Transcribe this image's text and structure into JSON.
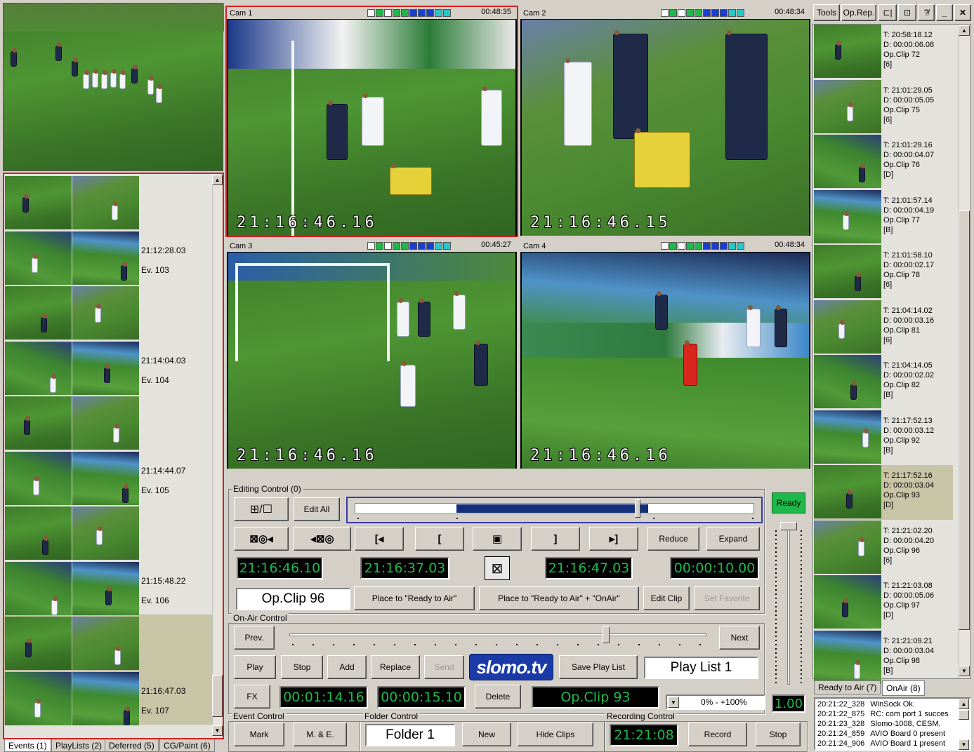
{
  "colors": {
    "meter_green": "#1fb84a",
    "meter_blue": "#1a3fd0",
    "meter_cyan": "#27c7c7",
    "lcd_text": "#1fb84a",
    "ready": "#1fb84a",
    "selected_border": "#d42020"
  },
  "cams": [
    {
      "label": "Cam 1",
      "time": "00:48:35",
      "timecode": "21:16:46.16"
    },
    {
      "label": "Cam 2",
      "time": "00:48:34",
      "timecode": "21:16:46.15"
    },
    {
      "label": "Cam 3",
      "time": "00:45:27",
      "timecode": "21:16:46.16"
    },
    {
      "label": "Cam 4",
      "time": "00:48:34",
      "timecode": "21:16:46.16"
    }
  ],
  "events": [
    {
      "time": "21:12:28.03",
      "name": "Ev. 103"
    },
    {
      "time": "21:14:04.03",
      "name": "Ev. 104"
    },
    {
      "time": "21:14:44.07",
      "name": "Ev. 105"
    },
    {
      "time": "21:15:48.22",
      "name": "Ev. 106"
    },
    {
      "time": "21:16:47.03",
      "name": "Ev. 107"
    }
  ],
  "left_tabs": [
    "Events (1)",
    "PlayLists (2)",
    "Deferred (5)",
    "CG/Paint (6)"
  ],
  "editing": {
    "group_label": "Editing Control (0)",
    "split_btn": "⊞/☐",
    "edit_all": "Edit All",
    "ready": "Ready",
    "trans_btns": [
      "▯◎◂",
      "◂▯◎",
      "[◂",
      "[",
      "▣",
      "]",
      "▸]"
    ],
    "reduce": "Reduce",
    "expand": "Expand",
    "tc_current": "21:16:46.10",
    "tc_in": "21:16:37.03",
    "tc_out": "21:16:47.03",
    "tc_dur": "00:00:10.00",
    "clip_name": "Op.Clip 96",
    "place_ready": "Place to \"Ready to Air\"",
    "place_ready_onair": "Place to \"Ready to Air\" + \"OnAir\"",
    "edit_clip": "Edit Clip",
    "set_favorite": "Set Favorite",
    "timeline_fill": 0.48
  },
  "onair": {
    "group_label": "On-Air Control",
    "prev": "Prev.",
    "next": "Next",
    "play": "Play",
    "stop": "Stop",
    "add": "Add",
    "replace": "Replace",
    "send": "Send",
    "logo": "slomo.tv",
    "save_playlist": "Save Play List",
    "playlist_name": "Play List 1",
    "fx": "FX",
    "tc_pos": "00:01:14.16",
    "tc_len": "00:00:15.10",
    "delete": "Delete",
    "onair_clip": "Op.Clip 93",
    "speed_range": "0%  -  +100%",
    "speed": "1.00",
    "slider_pos": 0.76
  },
  "event_control": {
    "group_label": "Event Control",
    "mark": "Mark",
    "me": "M. & E."
  },
  "folder_control": {
    "group_label": "Folder Control",
    "folder": "Folder 1",
    "new": "New",
    "hide_clips": "Hide Clips"
  },
  "recording_control": {
    "group_label": "Recording Control",
    "time": "21:21:08",
    "record": "Record",
    "stop": "Stop"
  },
  "top_right": {
    "tools": "Tools",
    "op_rep": "Op.Rep.",
    "icon1": "⊏|",
    "icon2": "⊡",
    "icon3": "?̸",
    "min": "_",
    "close": "✕"
  },
  "clips": [
    {
      "t": "T: 20:58:18.12",
      "d": "D: 00:00:06.08",
      "n": "Op.Clip 72",
      "tag": "[6]",
      "sel": false
    },
    {
      "t": "T: 21:01:29.05",
      "d": "D: 00:00:05.05",
      "n": "Op.Clip 75",
      "tag": "[6]",
      "sel": false
    },
    {
      "t": "T: 21:01:29.16",
      "d": "D: 00:00:04.07",
      "n": "Op.Clip 76",
      "tag": "[D]",
      "sel": false
    },
    {
      "t": "T: 21:01:57.14",
      "d": "D: 00:00:04.19",
      "n": "Op.Clip 77",
      "tag": "[B]",
      "sel": false
    },
    {
      "t": "T: 21:01:58.10",
      "d": "D: 00:00:02.17",
      "n": "Op.Clip 78",
      "tag": "[6]",
      "sel": false
    },
    {
      "t": "T: 21:04:14.02",
      "d": "D: 00:00:03.16",
      "n": "Op.Clip 81",
      "tag": "[6]",
      "sel": false
    },
    {
      "t": "T: 21:04:14.05",
      "d": "D: 00:00:02.02",
      "n": "Op.Clip 82",
      "tag": "[B]",
      "sel": false
    },
    {
      "t": "T: 21:17:52.13",
      "d": "D: 00:00:03.12",
      "n": "Op.Clip 92",
      "tag": "[B]",
      "sel": false
    },
    {
      "t": "T: 21:17:52.16",
      "d": "D: 00:00:03.04",
      "n": "Op.Clip 93",
      "tag": "[D]",
      "sel": true
    },
    {
      "t": "T: 21:21:02.20",
      "d": "D: 00:00:04.20",
      "n": "Op.Clip 96",
      "tag": "[6]",
      "sel": false
    },
    {
      "t": "T: 21:21:03.08",
      "d": "D: 00:00:05.06",
      "n": "Op.Clip 97",
      "tag": "[D]",
      "sel": false
    },
    {
      "t": "T: 21:21:09.21",
      "d": "D: 00:00:03.04",
      "n": "Op.Clip 98",
      "tag": "[B]",
      "sel": false
    }
  ],
  "right_tabs": [
    "Ready to Air (7)",
    "OnAir (8)"
  ],
  "log": [
    {
      "time": "20:21:22_328",
      "msg": "WinSock Ok."
    },
    {
      "time": "20:21:22_875",
      "msg": "RC: com port 1 succes"
    },
    {
      "time": "20:21:23_328",
      "msg": "Slomo-1008, CESM."
    },
    {
      "time": "20:21:24_859",
      "msg": "AVIO Board 0 present"
    },
    {
      "time": "20:21:24_906",
      "msg": "AVIO Board 1 present"
    }
  ]
}
